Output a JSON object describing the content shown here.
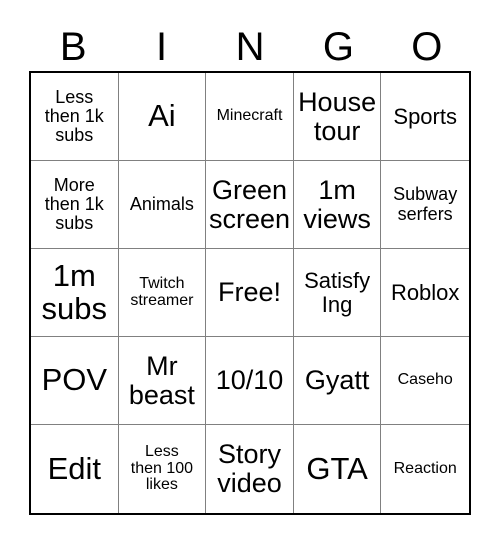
{
  "card": {
    "title_letters": [
      "B",
      "I",
      "N",
      "G",
      "O"
    ],
    "columns": 5,
    "rows": 5,
    "border_color": "#000000",
    "grid_line_color": "#808080",
    "background_color": "#ffffff",
    "text_color": "#000000"
  },
  "cells": [
    {
      "text": "Less\nthen 1k\nsubs",
      "size": "sm"
    },
    {
      "text": "Ai",
      "size": "xl"
    },
    {
      "text": "Minecraft",
      "size": "xs"
    },
    {
      "text": "House\ntour",
      "size": "lg"
    },
    {
      "text": "Sports",
      "size": "md"
    },
    {
      "text": "More\nthen 1k\nsubs",
      "size": "sm"
    },
    {
      "text": "Animals",
      "size": "sm"
    },
    {
      "text": "Green\nscreen",
      "size": "lg"
    },
    {
      "text": "1m\nviews",
      "size": "lg"
    },
    {
      "text": "Subway\nserfers",
      "size": "sm"
    },
    {
      "text": "1m\nsubs",
      "size": "xl"
    },
    {
      "text": "Twitch\nstreamer",
      "size": "xs"
    },
    {
      "text": "Free!",
      "size": "lg"
    },
    {
      "text": "Satisfy\nIng",
      "size": "md"
    },
    {
      "text": "Roblox",
      "size": "md"
    },
    {
      "text": "POV",
      "size": "xl"
    },
    {
      "text": "Mr\nbeast",
      "size": "lg"
    },
    {
      "text": "10/10",
      "size": "lg"
    },
    {
      "text": "Gyatt",
      "size": "lg"
    },
    {
      "text": "Caseho",
      "size": "xs"
    },
    {
      "text": "Edit",
      "size": "xl"
    },
    {
      "text": "Less\nthen 100\nlikes",
      "size": "xs"
    },
    {
      "text": "Story\nvideo",
      "size": "lg"
    },
    {
      "text": "GTA",
      "size": "xl"
    },
    {
      "text": "Reaction",
      "size": "xs"
    }
  ]
}
